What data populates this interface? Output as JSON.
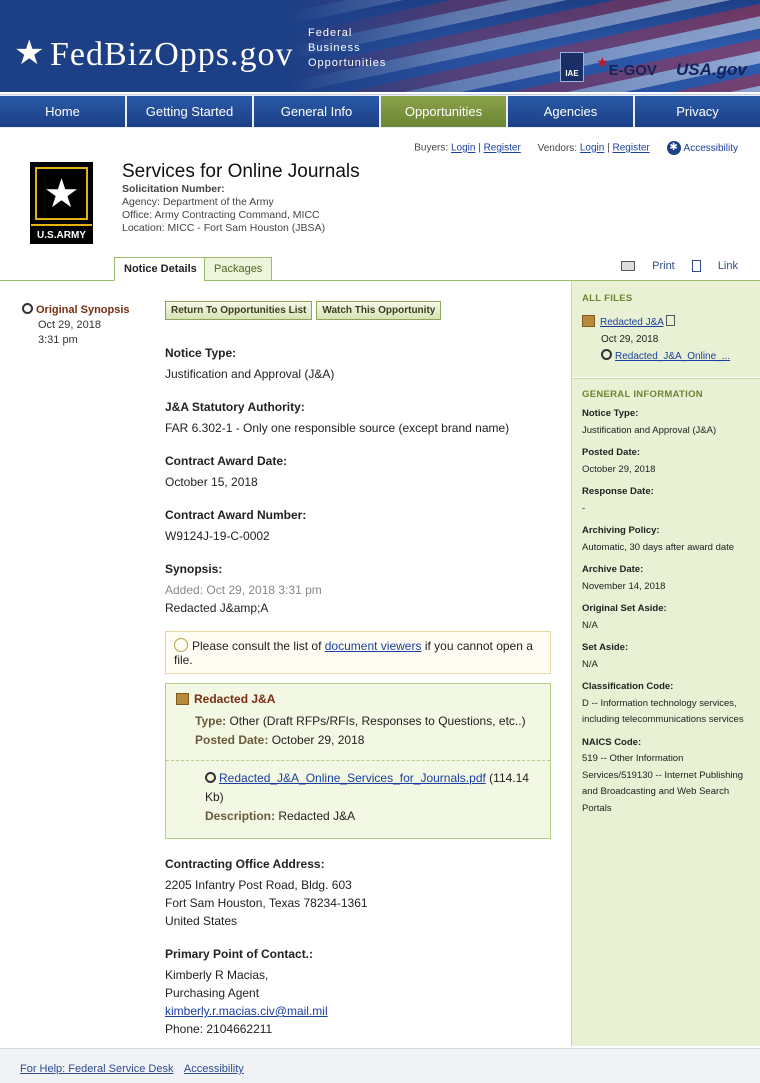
{
  "header": {
    "logo_text": "FedBizOpps.gov",
    "logo_subtitle": [
      "Federal",
      "Business",
      "Opportunities"
    ],
    "partners": {
      "iae": "IAE",
      "egov": "E-GOV",
      "usagov": "USA.gov"
    }
  },
  "nav": [
    {
      "label": "Home",
      "active": false
    },
    {
      "label": "Getting Started",
      "active": false
    },
    {
      "label": "General Info",
      "active": false
    },
    {
      "label": "Opportunities",
      "active": true
    },
    {
      "label": "Agencies",
      "active": false
    },
    {
      "label": "Privacy",
      "active": false
    }
  ],
  "toplinks": {
    "buyers": "Buyers:",
    "vendors": "Vendors:",
    "login": "Login",
    "register": "Register",
    "accessibility": "Accessibility"
  },
  "agency": {
    "logo_text": "U.S.ARMY",
    "title": "Services for Online Journals",
    "solicitation_label": "Solicitation Number:",
    "agency_line": "Agency: Department of the Army",
    "office_line": "Office: Army Contracting Command, MICC",
    "location_line": "Location: MICC - Fort Sam Houston (JBSA)"
  },
  "tabs": [
    "Notice Details",
    "Packages"
  ],
  "tools": {
    "print": "Print",
    "link": "Link"
  },
  "left": {
    "synopsis_title": "Original Synopsis",
    "date": "Oct 29, 2018",
    "time": "3:31 pm"
  },
  "buttons": {
    "return": "Return To Opportunities List",
    "watch": "Watch This Opportunity"
  },
  "fields": {
    "notice_type_label": "Notice Type:",
    "notice_type": "Justification and Approval (J&A)",
    "authority_label": "J&A Statutory Authority:",
    "authority": "FAR 6.302-1 - Only one responsible source (except brand name)",
    "award_date_label": "Contract Award Date:",
    "award_date": "October 15, 2018",
    "award_number_label": "Contract Award Number:",
    "award_number": "W9124J-19-C-0002",
    "synopsis_label": "Synopsis:",
    "synopsis_added": "Added: Oct 29, 2018 3:31 pm",
    "synopsis_text": "Redacted J&amp;A"
  },
  "note": {
    "before": "Please consult the list of",
    "link": "document viewers",
    "after": "if you cannot open a file."
  },
  "package": {
    "title": "Redacted J&A",
    "type_label": "Type:",
    "type": "Other (Draft RFPs/RFIs, Responses to Questions, etc..)",
    "posted_label": "Posted Date:",
    "posted": "October 29, 2018",
    "file_link": "Redacted_J&A_Online_Services_for_Journals.pdf",
    "file_size": "(114.14 Kb)",
    "desc_label": "Description:",
    "desc": "Redacted J&A"
  },
  "contact": {
    "office_label": "Contracting Office Address:",
    "office_lines": [
      "2205 Infantry Post Road, Bldg. 603",
      "Fort Sam Houston, Texas 78234-1361",
      "United States"
    ],
    "poc_label": "Primary Point of Contact.:",
    "name": "Kimberly R Macias,",
    "title": "Purchasing Agent",
    "email": "kimberly.r.macias.civ@mail.mil",
    "phone": "Phone: 2104662211"
  },
  "right": {
    "all_files_head": "ALL FILES",
    "file1": "Redacted J&A",
    "file1_date": "Oct 29, 2018",
    "file2": "Redacted_J&A_Online_...",
    "gen_head": "GENERAL INFORMATION",
    "items": [
      {
        "label": "Notice Type:",
        "value": "Justification and Approval (J&A)"
      },
      {
        "label": "Posted Date:",
        "value": "October 29, 2018"
      },
      {
        "label": "Response Date:",
        "value": "-"
      },
      {
        "label": "Archiving Policy:",
        "value": "Automatic, 30 days after award date"
      },
      {
        "label": "Archive Date:",
        "value": "November 14, 2018"
      },
      {
        "label": "Original Set Aside:",
        "value": "N/A"
      },
      {
        "label": "Set Aside:",
        "value": "N/A"
      },
      {
        "label": "Classification Code:",
        "value": "D -- Information technology services, including telecommunications services"
      },
      {
        "label": "NAICS Code:",
        "value": "519 -- Other Information Services/519130 -- Internet Publishing and Broadcasting and Web Search Portals"
      }
    ]
  },
  "footer": {
    "help": "For Help: Federal Service Desk",
    "accessibility": "Accessibility"
  }
}
